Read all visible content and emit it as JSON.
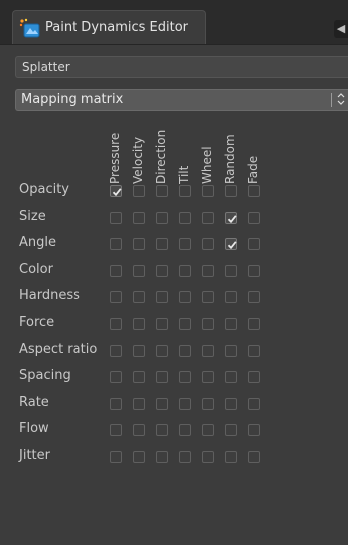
{
  "tab": {
    "title": "Paint Dynamics Editor",
    "icon": "paint-dynamics-icon",
    "menu_glyph": "◀"
  },
  "preset": {
    "name": "Splatter"
  },
  "mode": {
    "selected": "Mapping matrix",
    "arrows": "◇"
  },
  "columns": [
    "Pressure",
    "Velocity",
    "Direction",
    "Tilt",
    "Wheel",
    "Random",
    "Fade"
  ],
  "rows": [
    {
      "label": "Opacity",
      "checks": [
        true,
        false,
        false,
        false,
        false,
        false,
        false
      ]
    },
    {
      "label": "Size",
      "checks": [
        false,
        false,
        false,
        false,
        false,
        true,
        false
      ]
    },
    {
      "label": "Angle",
      "checks": [
        false,
        false,
        false,
        false,
        false,
        true,
        false
      ]
    },
    {
      "label": "Color",
      "checks": [
        false,
        false,
        false,
        false,
        false,
        false,
        false
      ]
    },
    {
      "label": "Hardness",
      "checks": [
        false,
        false,
        false,
        false,
        false,
        false,
        false
      ]
    },
    {
      "label": "Force",
      "checks": [
        false,
        false,
        false,
        false,
        false,
        false,
        false
      ]
    },
    {
      "label": "Aspect ratio",
      "checks": [
        false,
        false,
        false,
        false,
        false,
        false,
        false
      ]
    },
    {
      "label": "Spacing",
      "checks": [
        false,
        false,
        false,
        false,
        false,
        false,
        false
      ]
    },
    {
      "label": "Rate",
      "checks": [
        false,
        false,
        false,
        false,
        false,
        false,
        false
      ]
    },
    {
      "label": "Flow",
      "checks": [
        false,
        false,
        false,
        false,
        false,
        false,
        false
      ]
    },
    {
      "label": "Jitter",
      "checks": [
        false,
        false,
        false,
        false,
        false,
        false,
        false
      ]
    }
  ]
}
